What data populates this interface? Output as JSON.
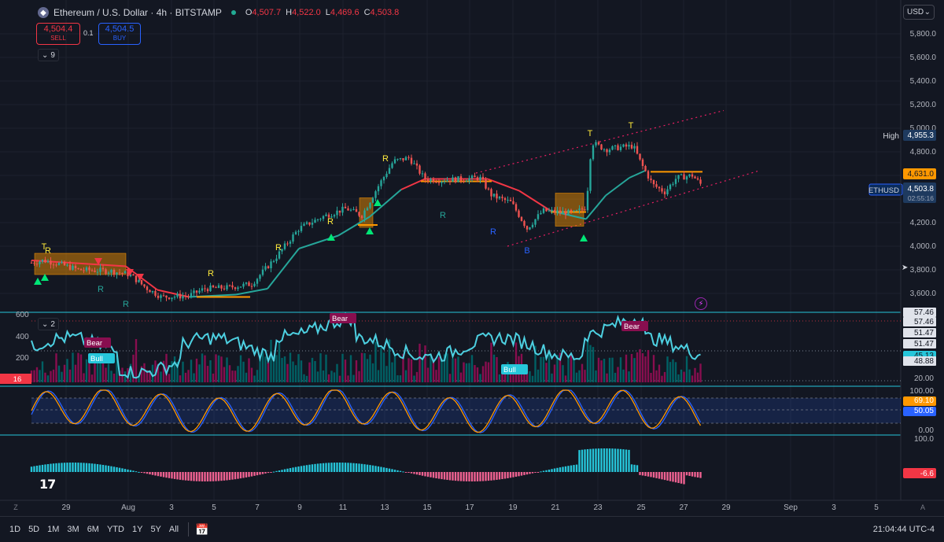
{
  "header": {
    "symbol_icon": "ethereum-icon",
    "title": "Ethereum / U.S. Dollar · 4h · BITSTAMP",
    "ohlc": [
      {
        "k": "O",
        "v": "4,507.7"
      },
      {
        "k": "H",
        "v": "4,522.0"
      },
      {
        "k": "L",
        "v": "4,469.6"
      },
      {
        "k": "C",
        "v": "4,503.8"
      }
    ]
  },
  "trade": {
    "sell_price": "4,504.4",
    "sell_label": "SELL",
    "qty": "0.1",
    "buy_price": "4,504.5",
    "buy_label": "BUY"
  },
  "indicator_counts": {
    "main": "9",
    "osc": "2"
  },
  "currency": "USD",
  "price_axis": {
    "ticks": [
      "5,800.0",
      "5,600.0",
      "5,400.0",
      "5,200.0",
      "5,000.0",
      "4,800.0",
      "4,600.0",
      "4,400.0",
      "4,200.0",
      "4,000.0",
      "3,800.0",
      "3,600.0"
    ],
    "high_label": "High",
    "high_value": "4,955.3",
    "level_value": "4,631.0",
    "symbol_tag": "ETHUSD",
    "last_price": "4,503.8",
    "countdown": "02:55:16"
  },
  "pane1": {
    "ticks": [
      "600",
      "400",
      "200"
    ],
    "right_labels": [
      "57.46",
      "57.46",
      "51.47",
      "51.47",
      "45.13",
      "48.88",
      "20.00"
    ],
    "value_tag": "45.13",
    "bottom_badge": "16",
    "bear": "Bear",
    "bull": "Bull"
  },
  "pane2": {
    "right_labels": [
      "100.00",
      "0.00"
    ],
    "k_value": "69.10",
    "d_value": "50.05"
  },
  "pane3": {
    "top_label": "100.0",
    "value_tag": "-6.6"
  },
  "signals": {
    "r": "R",
    "t": "T",
    "b": "B"
  },
  "time_axis": {
    "labels": [
      "29",
      "Aug",
      "3",
      "5",
      "7",
      "9",
      "11",
      "13",
      "15",
      "17",
      "19",
      "21",
      "23",
      "25",
      "27",
      "29",
      "Sep",
      "3",
      "5"
    ]
  },
  "bottom": {
    "timeframes": [
      "1D",
      "5D",
      "1M",
      "3M",
      "6M",
      "YTD",
      "1Y",
      "5Y",
      "All"
    ],
    "clock": "21:04:44 UTC-4"
  },
  "colors": {
    "bg": "#131722",
    "up": "#26a69a",
    "down": "#ef5350",
    "grid": "#1e222d",
    "pane_border": "#26c6da",
    "orange": "#ff9800",
    "aqua": "#4dd0e1"
  }
}
